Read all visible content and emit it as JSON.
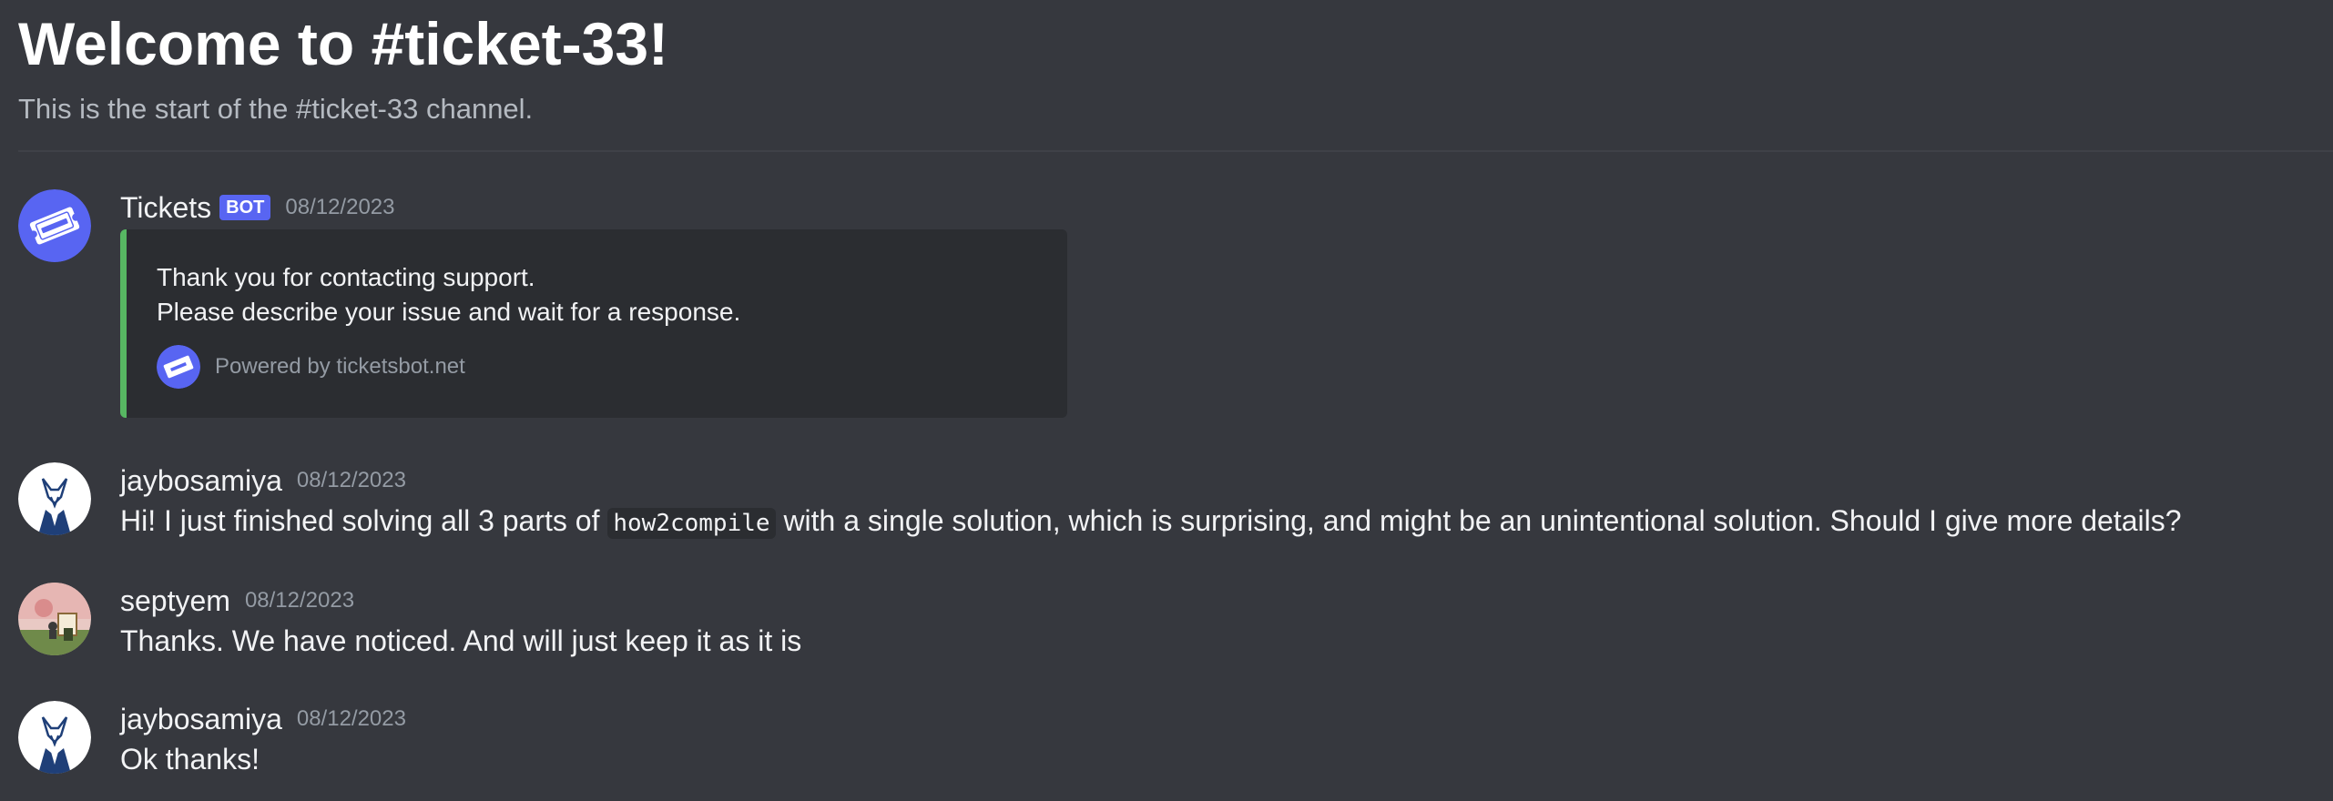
{
  "channel": {
    "welcome_title": "Welcome to #ticket-33!",
    "welcome_subtitle": "This is the start of the #ticket-33 channel."
  },
  "messages": [
    {
      "author": "Tickets",
      "badge": "BOT",
      "timestamp": "08/12/2023",
      "avatar_icon": "tickets-bot-avatar",
      "embed": {
        "line1": "Thank you for contacting support.",
        "line2": "Please describe your issue and wait for a response.",
        "footer": "Powered by ticketsbot.net",
        "accent_color": "#57b762"
      }
    },
    {
      "author": "jaybosamiya",
      "timestamp": "08/12/2023",
      "avatar_icon": "fox-avatar",
      "text_before": "Hi! I just finished solving all 3 parts of",
      "code": "how2compile",
      "text_after": "with a single solution, which is surprising, and might be an unintentional solution. Should I give more details?"
    },
    {
      "author": "septyem",
      "timestamp": "08/12/2023",
      "avatar_icon": "scenery-avatar",
      "text": "Thanks. We have noticed. And will just keep it as it is"
    },
    {
      "author": "jaybosamiya",
      "timestamp": "08/12/2023",
      "avatar_icon": "fox-avatar",
      "text": "Ok thanks!"
    }
  ],
  "colors": {
    "background": "#36383e",
    "bot_badge": "#5865f2",
    "embed_bg": "#2b2d31",
    "timestamp": "#949ba4"
  }
}
